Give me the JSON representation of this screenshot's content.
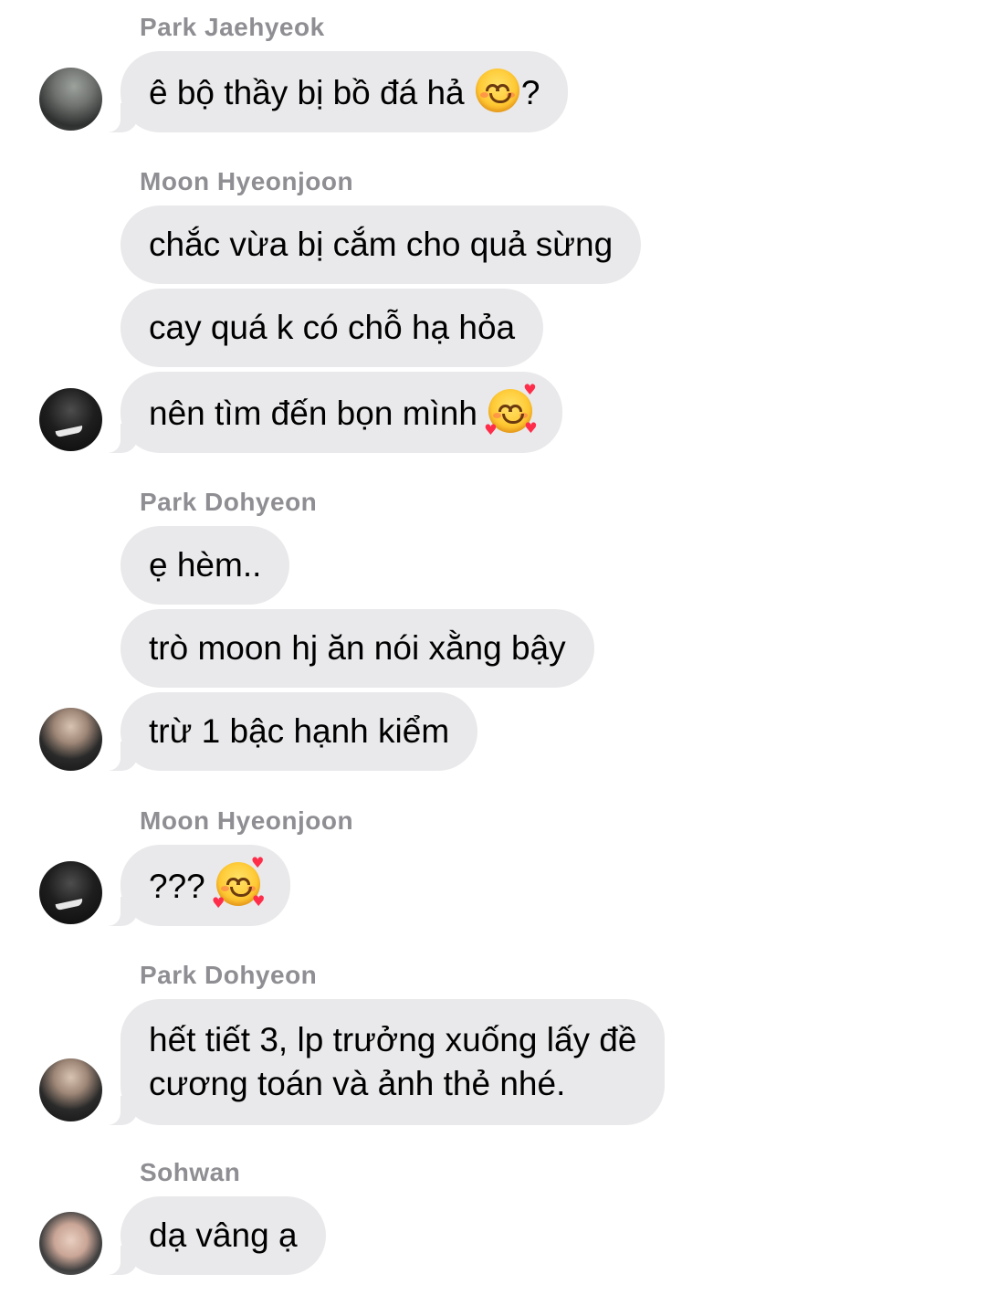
{
  "chat": {
    "groups": [
      {
        "sender": "Park Jaehyeok",
        "messages": [
          {
            "text": "ê bộ thầy bị bồ đá hả ",
            "emoji": "smiling-face-with-smiling-eyes",
            "suffix": "?"
          }
        ]
      },
      {
        "sender": "Moon Hyeonjoon",
        "messages": [
          {
            "text": "chắc vừa bị cắm cho quả sừng"
          },
          {
            "text": "cay quá k có chỗ hạ hỏa"
          },
          {
            "text": "nên tìm đến bọn mình ",
            "emoji": "smiling-face-with-hearts"
          }
        ]
      },
      {
        "sender": "Park Dohyeon",
        "messages": [
          {
            "text": "ẹ hèm.."
          },
          {
            "text": "trò moon hj ăn nói xằng bậy"
          },
          {
            "text": "trừ 1 bậc hạnh kiểm"
          }
        ]
      },
      {
        "sender": "Moon Hyeonjoon",
        "messages": [
          {
            "text": "??? ",
            "emoji": "smiling-face-with-hearts"
          }
        ]
      },
      {
        "sender": "Park Dohyeon",
        "messages": [
          {
            "line1": "hết tiết 3, lp trưởng xuống lấy đề",
            "line2": "cương toán và ảnh thẻ nhé."
          }
        ]
      },
      {
        "sender": "Sohwan",
        "messages": [
          {
            "text": "dạ vâng ạ"
          }
        ]
      }
    ]
  },
  "colors": {
    "bubble_bg": "#e9e9eb",
    "sender_text": "#8e8e93",
    "message_text": "#000000"
  }
}
